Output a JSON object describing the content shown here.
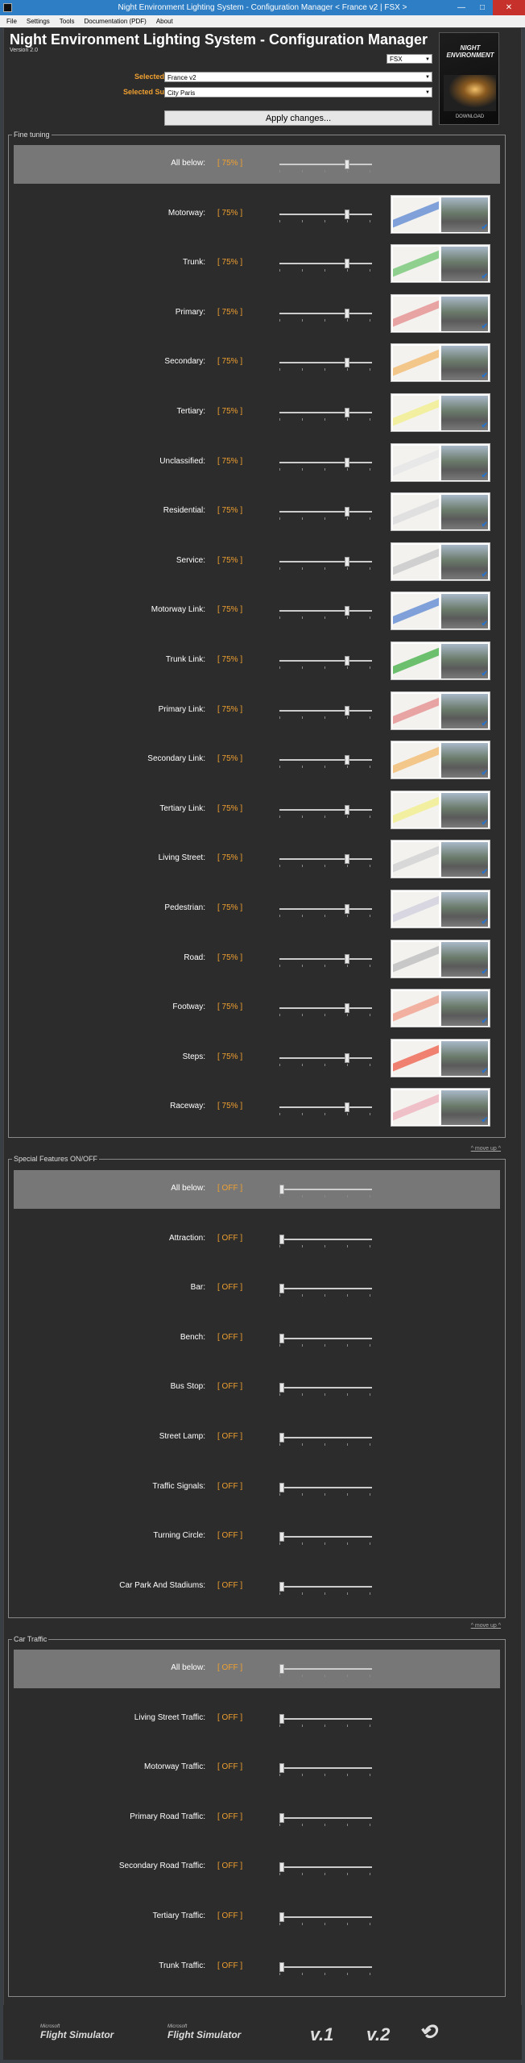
{
  "window": {
    "title": "Night Environment Lighting System - Configuration Manager < France v2 | FSX >"
  },
  "menu": [
    "File",
    "Settings",
    "Tools",
    "Documentation (PDF)",
    "About"
  ],
  "header": {
    "title": "Night Environment Lighting System - Configuration Manager",
    "version": "Version 2.0",
    "sim": "FSX",
    "region_label": "Selected Region:",
    "region": "France v2",
    "subregion_label": "Selected Subregion:",
    "subregion": "City Paris",
    "apply": "Apply changes...",
    "box_title": "NIGHT ENVIRONMENT",
    "box_download": "DOWNLOAD"
  },
  "move_up": "^ move up ^",
  "sections": [
    {
      "title": "Fine tuning",
      "rows": [
        {
          "label": "All below:",
          "value": "[ 75% ]",
          "level": 0.75,
          "highlight": true
        },
        {
          "label": "Motorway:",
          "value": "[ 75% ]",
          "level": 0.75,
          "map": "#7fa0d8"
        },
        {
          "label": "Trunk:",
          "value": "[ 75% ]",
          "level": 0.75,
          "map": "#8fd08f"
        },
        {
          "label": "Primary:",
          "value": "[ 75% ]",
          "level": 0.75,
          "map": "#e8a3a3"
        },
        {
          "label": "Secondary:",
          "value": "[ 75% ]",
          "level": 0.75,
          "map": "#f3c68a"
        },
        {
          "label": "Tertiary:",
          "value": "[ 75% ]",
          "level": 0.75,
          "map": "#f2f0a0"
        },
        {
          "label": "Unclassified:",
          "value": "[ 75% ]",
          "level": 0.75,
          "map": "#e8e8e8"
        },
        {
          "label": "Residential:",
          "value": "[ 75% ]",
          "level": 0.75,
          "map": "#e0e0e0"
        },
        {
          "label": "Service:",
          "value": "[ 75% ]",
          "level": 0.75,
          "map": "#d0d0d0"
        },
        {
          "label": "Motorway Link:",
          "value": "[ 75% ]",
          "level": 0.75,
          "map": "#7fa0d8"
        },
        {
          "label": "Trunk Link:",
          "value": "[ 75% ]",
          "level": 0.75,
          "map": "#6cbf6c"
        },
        {
          "label": "Primary Link:",
          "value": "[ 75% ]",
          "level": 0.75,
          "map": "#e8a3a3"
        },
        {
          "label": "Secondary Link:",
          "value": "[ 75% ]",
          "level": 0.75,
          "map": "#f3c68a"
        },
        {
          "label": "Tertiary Link:",
          "value": "[ 75% ]",
          "level": 0.75,
          "map": "#f2f0a0"
        },
        {
          "label": "Living Street:",
          "value": "[ 75% ]",
          "level": 0.75,
          "map": "#d8d8d8"
        },
        {
          "label": "Pedestrian:",
          "value": "[ 75% ]",
          "level": 0.75,
          "map": "#d8d6e0"
        },
        {
          "label": "Road:",
          "value": "[ 75% ]",
          "level": 0.75,
          "map": "#c8c8c8"
        },
        {
          "label": "Footway:",
          "value": "[ 75% ]",
          "level": 0.75,
          "map": "#f2b0a0"
        },
        {
          "label": "Steps:",
          "value": "[ 75% ]",
          "level": 0.75,
          "map": "#f08070"
        },
        {
          "label": "Raceway:",
          "value": "[ 75% ]",
          "level": 0.75,
          "map": "#f0c0c8"
        }
      ]
    },
    {
      "title": "Special Features ON/OFF",
      "rows": [
        {
          "label": "All below:",
          "value": "[ OFF ]",
          "level": 0,
          "highlight": true
        },
        {
          "label": "Attraction:",
          "value": "[ OFF ]",
          "level": 0
        },
        {
          "label": "Bar:",
          "value": "[ OFF ]",
          "level": 0
        },
        {
          "label": "Bench:",
          "value": "[ OFF ]",
          "level": 0
        },
        {
          "label": "Bus Stop:",
          "value": "[ OFF ]",
          "level": 0
        },
        {
          "label": "Street Lamp:",
          "value": "[ OFF ]",
          "level": 0
        },
        {
          "label": "Traffic Signals:",
          "value": "[ OFF ]",
          "level": 0
        },
        {
          "label": "Turning Circle:",
          "value": "[ OFF ]",
          "level": 0
        },
        {
          "label": "Car Park And Stadiums:",
          "value": "[ OFF ]",
          "level": 0
        }
      ]
    },
    {
      "title": "Car Traffic",
      "rows": [
        {
          "label": "All below:",
          "value": "[ OFF ]",
          "level": 0,
          "highlight": true
        },
        {
          "label": "Living Street Traffic:",
          "value": "[ OFF ]",
          "level": 0
        },
        {
          "label": "Motorway Traffic:",
          "value": "[ OFF ]",
          "level": 0
        },
        {
          "label": "Primary Road Traffic:",
          "value": "[ OFF ]",
          "level": 0
        },
        {
          "label": "Secondary Road Traffic:",
          "value": "[ OFF ]",
          "level": 0
        },
        {
          "label": "Tertiary Traffic:",
          "value": "[ OFF ]",
          "level": 0
        },
        {
          "label": "Trunk Traffic:",
          "value": "[ OFF ]",
          "level": 0
        }
      ]
    }
  ],
  "footer": {
    "logo1": "Flight Simulator",
    "logo1_small": "Microsoft",
    "logo2": "Flight Simulator",
    "logo2_small": "Microsoft",
    "logo3": "v.1",
    "logo4": "v.2"
  }
}
